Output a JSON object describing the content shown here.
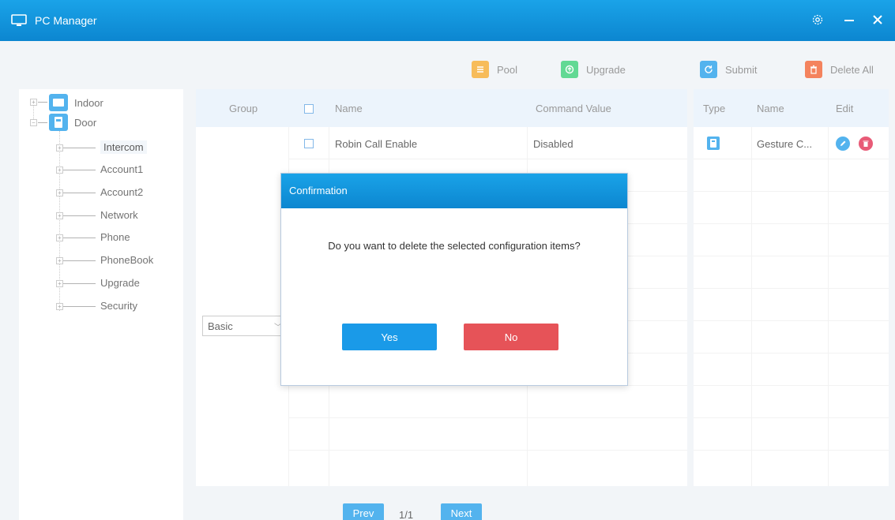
{
  "window": {
    "title": "PC Manager"
  },
  "toolbar": {
    "pool": "Pool",
    "upgrade": "Upgrade",
    "submit": "Submit",
    "delete_all": "Delete All"
  },
  "tree": {
    "indoor": "Indoor",
    "door": "Door",
    "children": [
      "Intercom",
      "Account1",
      "Account2",
      "Network",
      "Phone",
      "PhoneBook",
      "Upgrade",
      "Security"
    ]
  },
  "grid": {
    "headers": {
      "group": "Group",
      "name": "Name",
      "value": "Command Value"
    },
    "group_select": "Basic",
    "rows": [
      {
        "name": "Robin Call Enable",
        "value": "Disabled"
      }
    ]
  },
  "right_panel": {
    "headers": {
      "type": "Type",
      "name": "Name",
      "edit": "Edit"
    },
    "rows": [
      {
        "name": "Gesture C..."
      }
    ]
  },
  "pager": {
    "prev": "Prev",
    "page": "1/1",
    "next": "Next"
  },
  "dialog": {
    "title": "Confirmation",
    "message": "Do you want to delete the selected configuration items?",
    "yes": "Yes",
    "no": "No"
  },
  "colors": {
    "accent": "#1a9ae8",
    "pool_icon": "#f5a623",
    "upgrade_icon": "#2ecc71",
    "submit_icon": "#1a9ae8",
    "delete_icon": "#f05a28",
    "no_button": "#e65358",
    "delete_round": "#e0244a"
  }
}
